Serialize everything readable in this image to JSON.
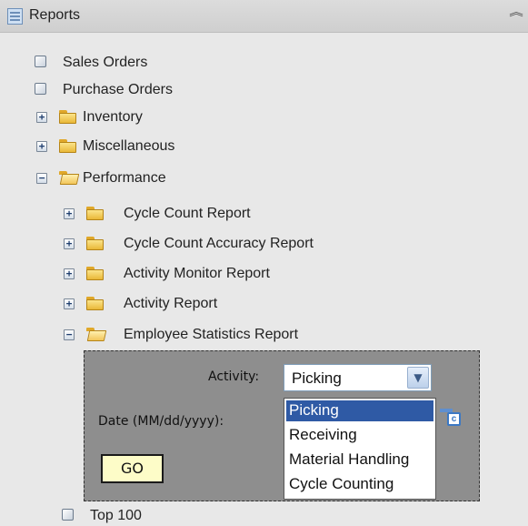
{
  "panel": {
    "title": "Reports"
  },
  "tree": {
    "sales_orders": "Sales Orders",
    "purchase_orders": "Purchase Orders",
    "inventory": "Inventory",
    "miscellaneous": "Miscellaneous",
    "performance": "Performance",
    "performance_children": {
      "cycle_count": "Cycle Count Report",
      "cycle_count_accuracy": "Cycle Count Accuracy Report",
      "activity_monitor": "Activity Monitor Report",
      "activity_report": "Activity Report",
      "employee_statistics": "Employee Statistics Report"
    },
    "top_100": "Top 100"
  },
  "toggles": {
    "expand": "+",
    "collapse": "−"
  },
  "form": {
    "activity_label": "Activity:",
    "activity_value": "Picking",
    "activity_options": [
      "Picking",
      "Receiving",
      "Material Handling",
      "Cycle Counting"
    ],
    "date_label": "Date (MM/dd/yyyy):",
    "go_label": "GO"
  },
  "icons": {
    "header": "report-list-icon",
    "collapse": "double-chevron-up-icon",
    "document": "document-icon",
    "folder": "folder-icon",
    "folder_open": "folder-open-icon",
    "calendar": "calendar-icon",
    "dropdown": "chevron-down-icon"
  },
  "colors": {
    "selected_option": "#2f5aa5",
    "go_button": "#fdfcc8",
    "form_panel": "#8e8e8e"
  }
}
